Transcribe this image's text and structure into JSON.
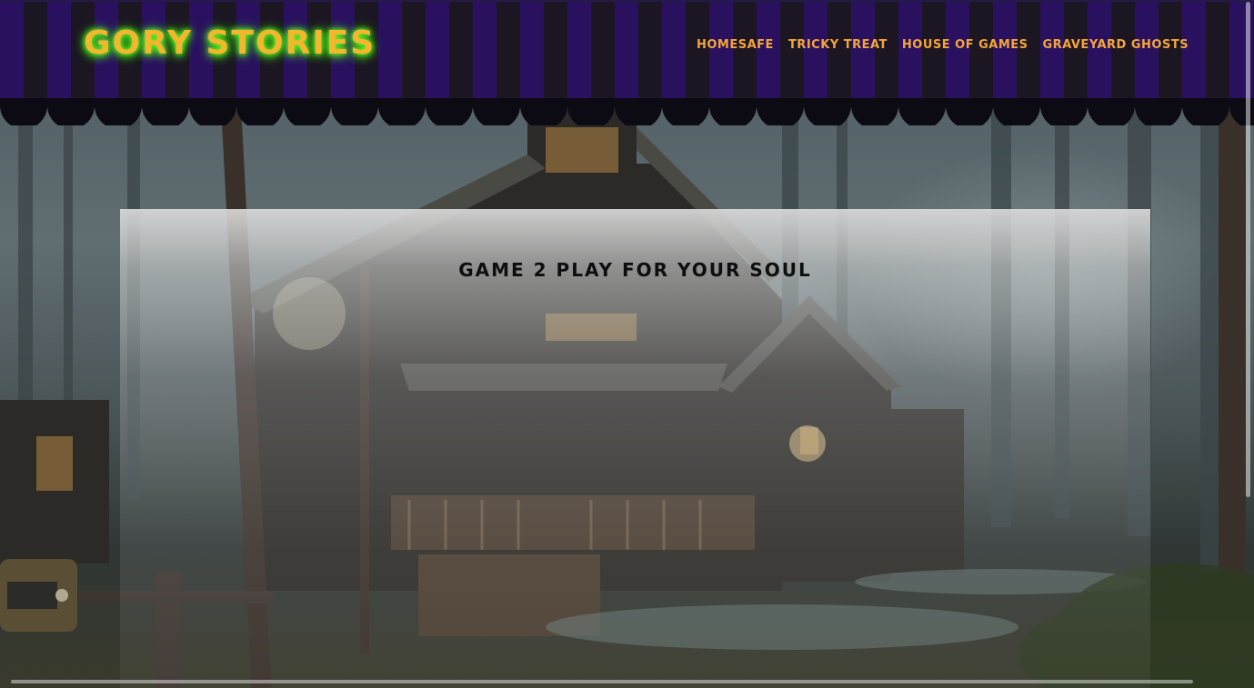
{
  "site": {
    "logo_text": "Gory Stories"
  },
  "nav": {
    "items": [
      {
        "label": "Homesafe"
      },
      {
        "label": "Tricky Treat"
      },
      {
        "label": "House of Games"
      },
      {
        "label": "Graveyard Ghosts"
      }
    ]
  },
  "main": {
    "title": "Game 2 Play for your soul"
  },
  "colors": {
    "stripe_purple": "#2a1160",
    "stripe_dark": "#1c1623",
    "logo": "#f3b62d",
    "logo_glow": "#3de010",
    "nav_link": "#f4a63a",
    "title": "#0e0e10"
  }
}
